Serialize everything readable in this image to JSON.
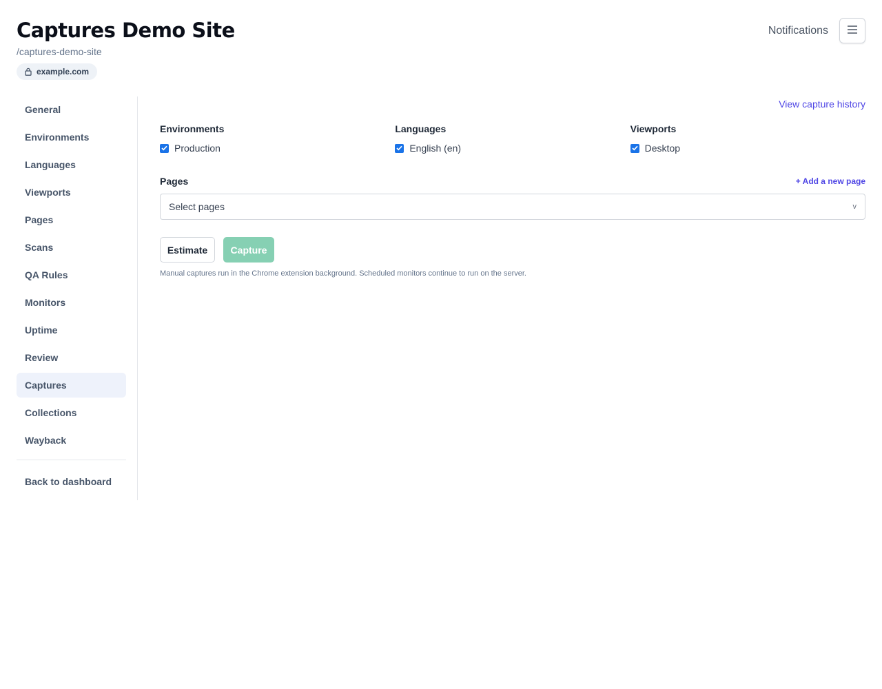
{
  "header": {
    "title": "Captures Demo Site",
    "slug": "/captures-demo-site",
    "domain": "example.com"
  },
  "topbar": {
    "notifications_label": "Notifications",
    "menu_icon": "hamburger-icon"
  },
  "sidebar": {
    "items": [
      {
        "label": "General"
      },
      {
        "label": "Environments"
      },
      {
        "label": "Languages"
      },
      {
        "label": "Viewports"
      },
      {
        "label": "Pages"
      },
      {
        "label": "Scans"
      },
      {
        "label": "QA Rules"
      },
      {
        "label": "Monitors"
      },
      {
        "label": "Uptime"
      },
      {
        "label": "Review"
      },
      {
        "label": "Captures",
        "active": true
      },
      {
        "label": "Collections"
      },
      {
        "label": "Wayback"
      }
    ],
    "back_label": "Back to dashboard"
  },
  "main": {
    "history_link": "View capture history",
    "filters": {
      "environments": {
        "title": "Environments",
        "option": "Production",
        "checked": true
      },
      "languages": {
        "title": "Languages",
        "option": "English (en)",
        "checked": true
      },
      "viewports": {
        "title": "Viewports",
        "option": "Desktop",
        "checked": true
      }
    },
    "pages": {
      "title": "Pages",
      "add_link": "+ Add a new page",
      "select_placeholder": "Select pages",
      "chevron": "v"
    },
    "actions": {
      "estimate_label": "Estimate",
      "capture_label": "Capture"
    },
    "note": "Manual captures run in the Chrome extension background. Scheduled monitors continue to run on the server."
  },
  "colors": {
    "accent": "#4f46e5",
    "capture_button": "#86d0b3",
    "checkbox": "#1a73e8",
    "active_nav_bg": "#eef2fb"
  }
}
